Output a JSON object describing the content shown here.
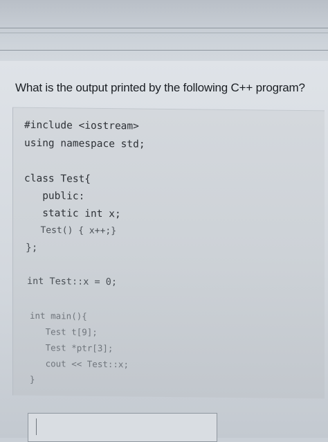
{
  "question": {
    "text": "What is the output printed by the following C++ program?"
  },
  "code": {
    "lines": [
      "#include <iostream>",
      "using namespace std;",
      "",
      "class Test{",
      "   public:",
      "   static int x;",
      "   Test() { x++;}",
      "};",
      "",
      "int Test::x = 0;",
      "",
      "int main(){",
      "   Test t[9];",
      "   Test *ptr[3];",
      "   cout << Test::x;",
      "}"
    ]
  },
  "answer": {
    "value": ""
  }
}
